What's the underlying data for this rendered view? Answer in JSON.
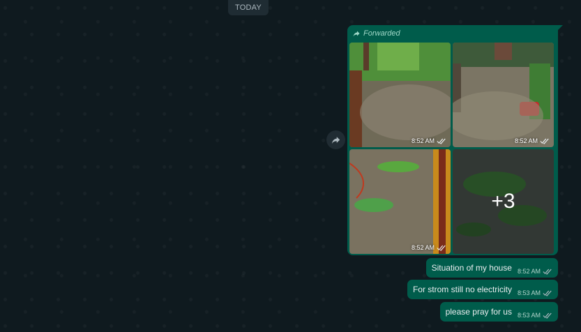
{
  "date_separator": "TODAY",
  "album": {
    "forwarded_label": "Forwarded",
    "tiles": [
      {
        "time": "8:52 AM"
      },
      {
        "time": "8:52 AM"
      },
      {
        "time": "8:52 AM"
      },
      {
        "more_count": "+3"
      }
    ]
  },
  "messages": [
    {
      "text": "Situation of my house",
      "time": "8:52 AM"
    },
    {
      "text": "For strom still no electricity",
      "time": "8:53 AM"
    },
    {
      "text": "please pray for us",
      "time": "8:53 AM"
    }
  ],
  "colors": {
    "outgoing_bubble": "#005c4b",
    "background": "#0b141a",
    "read_ticks": "#aebac1"
  },
  "icons": [
    "forward-icon",
    "double-check-icon"
  ]
}
